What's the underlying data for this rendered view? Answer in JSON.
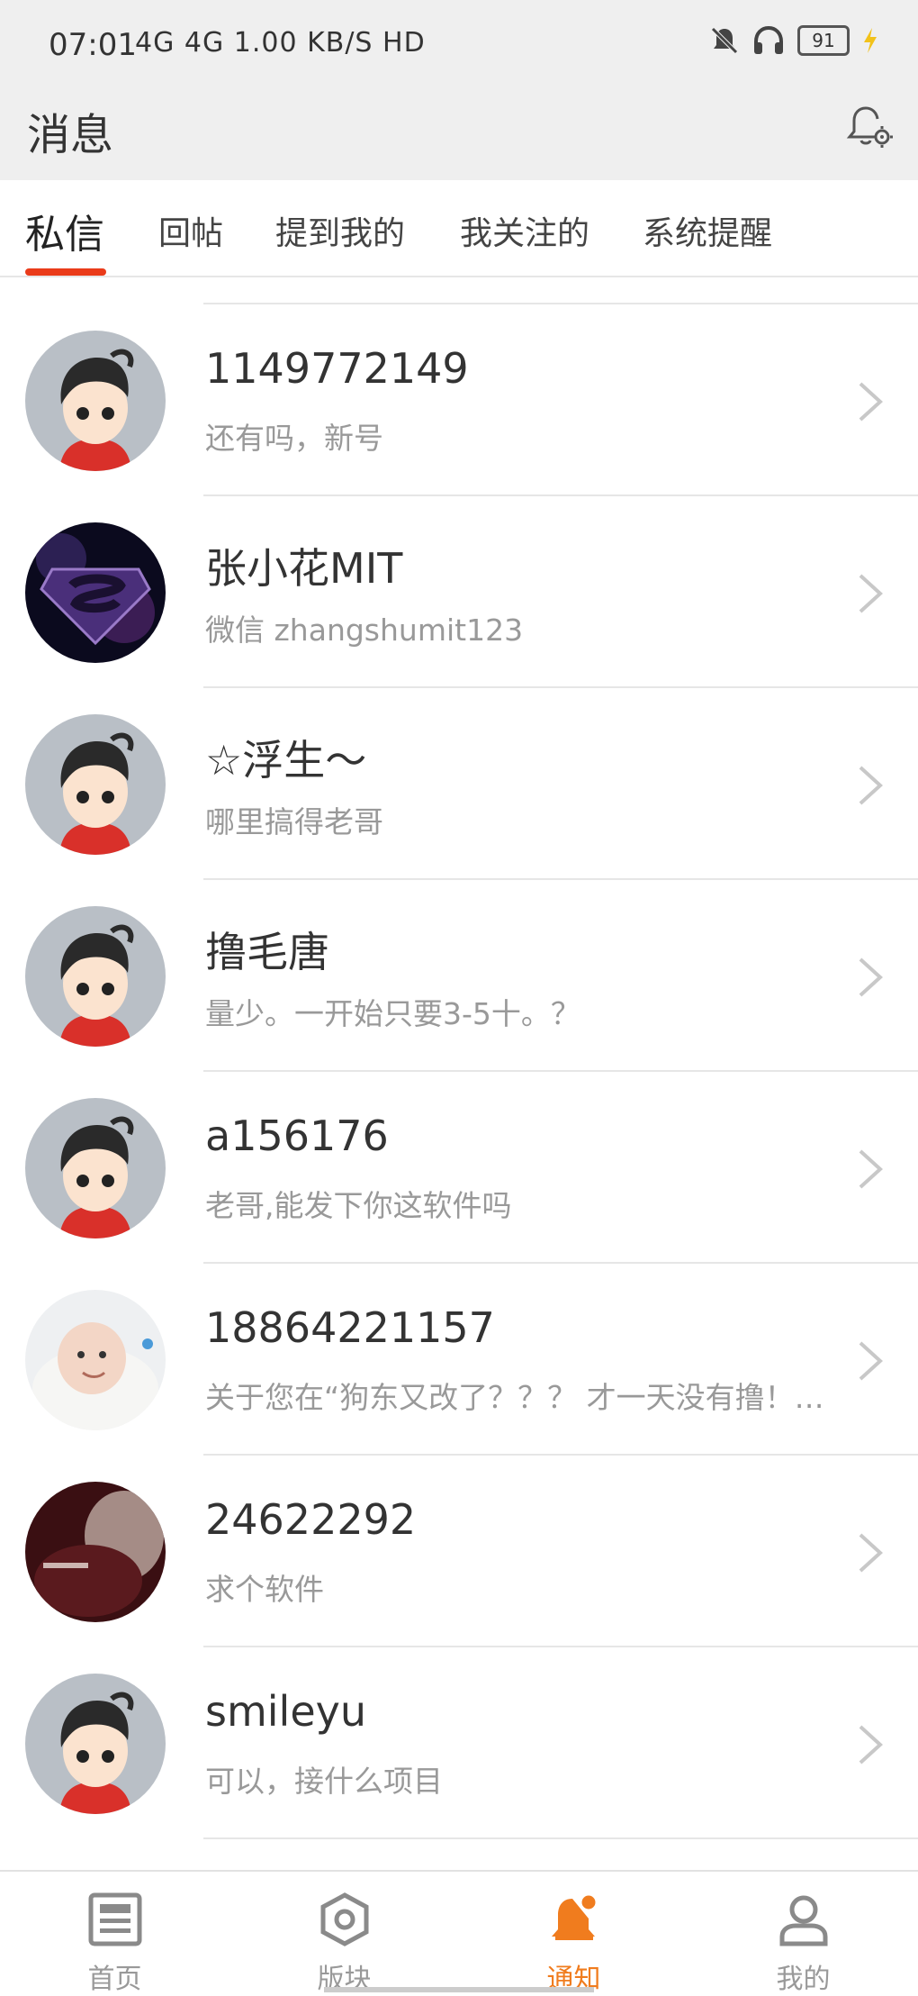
{
  "status_bar": {
    "time": "07:01",
    "network": "4G 4G 1.00 KB/S HD",
    "battery": "91"
  },
  "header": {
    "title": "消息"
  },
  "tabs": [
    {
      "label": "私信",
      "active": true
    },
    {
      "label": "回帖"
    },
    {
      "label": "提到我的"
    },
    {
      "label": "我关注的"
    },
    {
      "label": "系统提醒"
    }
  ],
  "messages": [
    {
      "name": "1149772149",
      "preview": "还有吗，新号",
      "avatar": "default-avatar"
    },
    {
      "name": "张小花MIT",
      "preview": "微信 zhangshumit123",
      "avatar": "galaxy-avatar"
    },
    {
      "name": "☆浮生～",
      "preview": "哪里搞得老哥",
      "avatar": "default-avatar"
    },
    {
      "name": "撸毛唐",
      "preview": "量少。一开始只要3-5十。？",
      "avatar": "default-avatar"
    },
    {
      "name": "a156176",
      "preview": "老哥,能发下你这软件吗",
      "avatar": "default-avatar"
    },
    {
      "name": "18864221157",
      "preview": "关于您在“狗东又改了？？？ 才一天没有撸！！…",
      "avatar": "baby-avatar"
    },
    {
      "name": "24622292",
      "preview": "求个软件",
      "avatar": "dark-photo-avatar"
    },
    {
      "name": "smileyu",
      "preview": "可以，接什么项目",
      "avatar": "default-avatar"
    }
  ],
  "bottom_nav": [
    {
      "label": "首页",
      "icon": "news-icon"
    },
    {
      "label": "版块",
      "icon": "hexagon-icon"
    },
    {
      "label": "通知",
      "icon": "bell-icon",
      "active": true
    },
    {
      "label": "我的",
      "icon": "person-icon"
    }
  ],
  "colors": {
    "accent": "#f07c1e",
    "tab_underline": "#ea3b1a"
  }
}
